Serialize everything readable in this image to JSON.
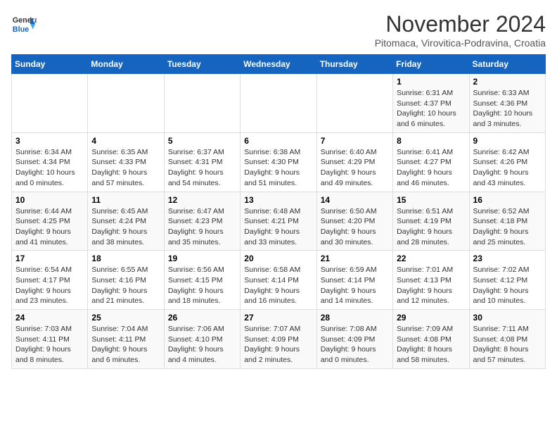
{
  "header": {
    "logo_line1": "General",
    "logo_line2": "Blue",
    "month_title": "November 2024",
    "subtitle": "Pitomaca, Virovitica-Podravina, Croatia"
  },
  "weekdays": [
    "Sunday",
    "Monday",
    "Tuesday",
    "Wednesday",
    "Thursday",
    "Friday",
    "Saturday"
  ],
  "weeks": [
    [
      {
        "day": "",
        "info": ""
      },
      {
        "day": "",
        "info": ""
      },
      {
        "day": "",
        "info": ""
      },
      {
        "day": "",
        "info": ""
      },
      {
        "day": "",
        "info": ""
      },
      {
        "day": "1",
        "info": "Sunrise: 6:31 AM\nSunset: 4:37 PM\nDaylight: 10 hours\nand 6 minutes."
      },
      {
        "day": "2",
        "info": "Sunrise: 6:33 AM\nSunset: 4:36 PM\nDaylight: 10 hours\nand 3 minutes."
      }
    ],
    [
      {
        "day": "3",
        "info": "Sunrise: 6:34 AM\nSunset: 4:34 PM\nDaylight: 10 hours\nand 0 minutes."
      },
      {
        "day": "4",
        "info": "Sunrise: 6:35 AM\nSunset: 4:33 PM\nDaylight: 9 hours\nand 57 minutes."
      },
      {
        "day": "5",
        "info": "Sunrise: 6:37 AM\nSunset: 4:31 PM\nDaylight: 9 hours\nand 54 minutes."
      },
      {
        "day": "6",
        "info": "Sunrise: 6:38 AM\nSunset: 4:30 PM\nDaylight: 9 hours\nand 51 minutes."
      },
      {
        "day": "7",
        "info": "Sunrise: 6:40 AM\nSunset: 4:29 PM\nDaylight: 9 hours\nand 49 minutes."
      },
      {
        "day": "8",
        "info": "Sunrise: 6:41 AM\nSunset: 4:27 PM\nDaylight: 9 hours\nand 46 minutes."
      },
      {
        "day": "9",
        "info": "Sunrise: 6:42 AM\nSunset: 4:26 PM\nDaylight: 9 hours\nand 43 minutes."
      }
    ],
    [
      {
        "day": "10",
        "info": "Sunrise: 6:44 AM\nSunset: 4:25 PM\nDaylight: 9 hours\nand 41 minutes."
      },
      {
        "day": "11",
        "info": "Sunrise: 6:45 AM\nSunset: 4:24 PM\nDaylight: 9 hours\nand 38 minutes."
      },
      {
        "day": "12",
        "info": "Sunrise: 6:47 AM\nSunset: 4:23 PM\nDaylight: 9 hours\nand 35 minutes."
      },
      {
        "day": "13",
        "info": "Sunrise: 6:48 AM\nSunset: 4:21 PM\nDaylight: 9 hours\nand 33 minutes."
      },
      {
        "day": "14",
        "info": "Sunrise: 6:50 AM\nSunset: 4:20 PM\nDaylight: 9 hours\nand 30 minutes."
      },
      {
        "day": "15",
        "info": "Sunrise: 6:51 AM\nSunset: 4:19 PM\nDaylight: 9 hours\nand 28 minutes."
      },
      {
        "day": "16",
        "info": "Sunrise: 6:52 AM\nSunset: 4:18 PM\nDaylight: 9 hours\nand 25 minutes."
      }
    ],
    [
      {
        "day": "17",
        "info": "Sunrise: 6:54 AM\nSunset: 4:17 PM\nDaylight: 9 hours\nand 23 minutes."
      },
      {
        "day": "18",
        "info": "Sunrise: 6:55 AM\nSunset: 4:16 PM\nDaylight: 9 hours\nand 21 minutes."
      },
      {
        "day": "19",
        "info": "Sunrise: 6:56 AM\nSunset: 4:15 PM\nDaylight: 9 hours\nand 18 minutes."
      },
      {
        "day": "20",
        "info": "Sunrise: 6:58 AM\nSunset: 4:14 PM\nDaylight: 9 hours\nand 16 minutes."
      },
      {
        "day": "21",
        "info": "Sunrise: 6:59 AM\nSunset: 4:14 PM\nDaylight: 9 hours\nand 14 minutes."
      },
      {
        "day": "22",
        "info": "Sunrise: 7:01 AM\nSunset: 4:13 PM\nDaylight: 9 hours\nand 12 minutes."
      },
      {
        "day": "23",
        "info": "Sunrise: 7:02 AM\nSunset: 4:12 PM\nDaylight: 9 hours\nand 10 minutes."
      }
    ],
    [
      {
        "day": "24",
        "info": "Sunrise: 7:03 AM\nSunset: 4:11 PM\nDaylight: 9 hours\nand 8 minutes."
      },
      {
        "day": "25",
        "info": "Sunrise: 7:04 AM\nSunset: 4:11 PM\nDaylight: 9 hours\nand 6 minutes."
      },
      {
        "day": "26",
        "info": "Sunrise: 7:06 AM\nSunset: 4:10 PM\nDaylight: 9 hours\nand 4 minutes."
      },
      {
        "day": "27",
        "info": "Sunrise: 7:07 AM\nSunset: 4:09 PM\nDaylight: 9 hours\nand 2 minutes."
      },
      {
        "day": "28",
        "info": "Sunrise: 7:08 AM\nSunset: 4:09 PM\nDaylight: 9 hours\nand 0 minutes."
      },
      {
        "day": "29",
        "info": "Sunrise: 7:09 AM\nSunset: 4:08 PM\nDaylight: 8 hours\nand 58 minutes."
      },
      {
        "day": "30",
        "info": "Sunrise: 7:11 AM\nSunset: 4:08 PM\nDaylight: 8 hours\nand 57 minutes."
      }
    ]
  ]
}
